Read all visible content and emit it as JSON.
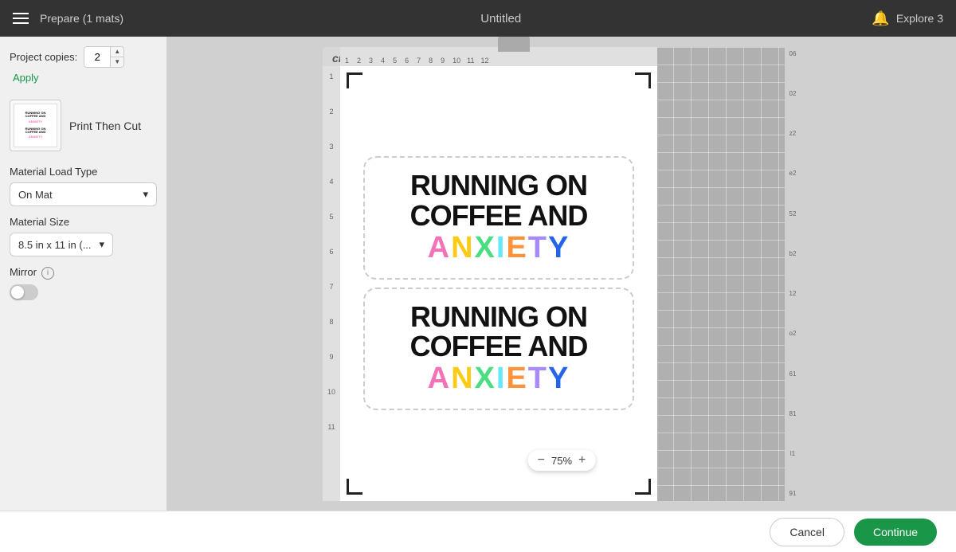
{
  "header": {
    "menu_label": "Menu",
    "title": "Untitled",
    "prepare_label": "Prepare (1 mats)",
    "explore_label": "Explore 3"
  },
  "sidebar": {
    "project_copies_label": "Project copies:",
    "copies_value": "2",
    "apply_label": "Apply",
    "mat_label": "Print Then Cut",
    "material_load_type_label": "Material Load Type",
    "on_mat_label": "On Mat",
    "material_size_label": "Material Size",
    "material_size_value": "8.5 in x 11 in (...",
    "mirror_label": "Mirror",
    "info_label": "i"
  },
  "canvas": {
    "zoom_value": "75%",
    "cricut_logo": "cricut",
    "zoom_minus": "−",
    "zoom_plus": "+"
  },
  "sticker": {
    "line1": "RUNNING ON",
    "line2": "COFFEE AND",
    "anxiety": [
      "A",
      "N",
      "X",
      "I",
      "E",
      "T",
      "Y"
    ],
    "anxiety_colors": [
      "#f472b6",
      "#facc15",
      "#4ade80",
      "#67e8f9",
      "#fb923c",
      "#a78bfa",
      "#2563eb"
    ]
  },
  "footer": {
    "cancel_label": "Cancel",
    "continue_label": "Continue"
  },
  "ruler": {
    "top_labels": [
      "1",
      "2",
      "3",
      "4",
      "5",
      "6",
      "7",
      "8",
      "9",
      "10",
      "11",
      "12"
    ],
    "left_labels": [
      "1",
      "2",
      "3",
      "4",
      "5",
      "6",
      "7",
      "8",
      "9",
      "10",
      "11"
    ]
  }
}
